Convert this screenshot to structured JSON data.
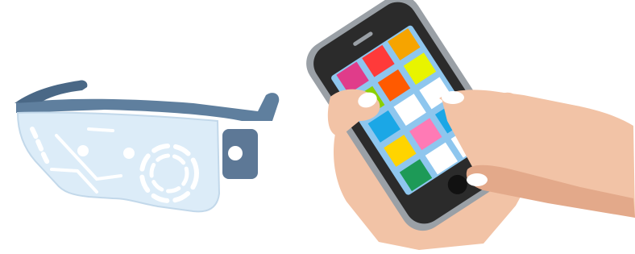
{
  "scene": {
    "left_object": "smart-glasses",
    "right_object": "smartphone-in-hand"
  },
  "colors": {
    "background": "#ffffff",
    "glasses_frame": "#5f7f9e",
    "glasses_frame_dark": "#4a6886",
    "glasses_lens": "#dcecf8",
    "glasses_lens_edge": "#c2d8ea",
    "glasses_hud_lines": "#ffffff",
    "camera_body": "#5d7896",
    "camera_lens": "#ffffff",
    "skin": "#f2c3a6",
    "skin_shadow": "#e3a98a",
    "nail": "#ffffff",
    "phone_body": "#2b2b2b",
    "phone_bezel": "#9aa0a6",
    "phone_screen": "#8ec6ee",
    "home_button": "#111111"
  },
  "phone": {
    "app_grid": [
      [
        "#e03c8a",
        "#ff3a3a",
        "#f6a400"
      ],
      [
        "#8bd000",
        "#ff5a00",
        "#e8f400"
      ],
      [
        "#1ba7e6",
        "#ffffff",
        "#ffffff"
      ],
      [
        "#ffd400",
        "#ff7ab5",
        "#1ba7e6"
      ],
      [
        "#1d9a57",
        "#ffffff",
        "#ffffff"
      ]
    ]
  }
}
